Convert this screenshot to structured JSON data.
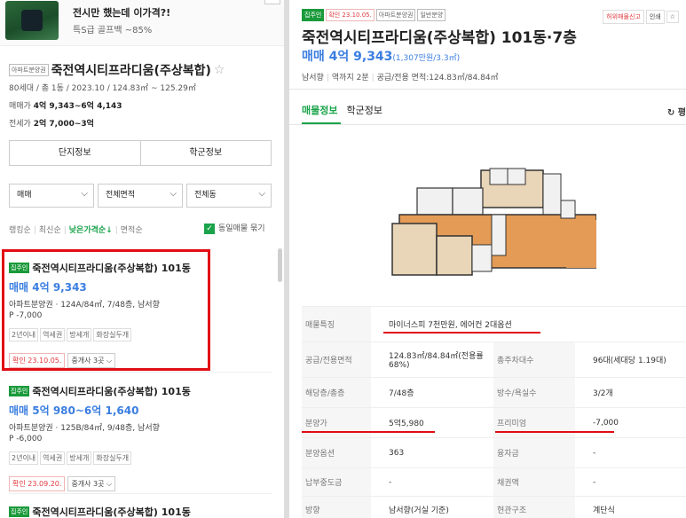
{
  "ad": {
    "title": "전시만 했는데 이가격?!",
    "subtitle": "특S급 골프백 ~85%"
  },
  "complex": {
    "type_tag": "아파트분양권",
    "name": "죽전역시티프라디움(주상복합)",
    "star": "☆",
    "meta": "80세대 / 총 1동 / 2023.10 / 124.83㎡ ~ 125.29㎡",
    "trade_label": "매매가",
    "trade_value": "4억 9,343~6억 4,143",
    "jeonse_label": "전세가",
    "jeonse_value": "2억 7,000~3억",
    "btn_info": "단지정보",
    "btn_school": "학군정보"
  },
  "filters": {
    "f1": "매매",
    "f2": "전체면적",
    "f3": "전체동"
  },
  "sort": {
    "s1": "랭킹순",
    "s2": "최신순",
    "s3": "낮은가격순↓",
    "s4": "면적순",
    "check_mark": "✓",
    "check_label": "동일매물 묶기"
  },
  "listings": [
    {
      "badge": "집주인",
      "name": "죽전역시티프라디움(주상복합) 101동",
      "price": "매매 4억 9,343",
      "desc": "아파트분양권 · 124A/84㎡, 7/48층, 남서향",
      "premium": "P -7,000",
      "kw1": "2년이내",
      "kw2": "역세권",
      "kw3": "방세개",
      "kw4": "화장실두개",
      "confirm": "확인 23.10.05.",
      "agents": "중개사 3곳 ⌵"
    },
    {
      "badge": "집주인",
      "name": "죽전역시티프라디움(주상복합) 101동",
      "price": "매매 5억 980~6억 1,640",
      "desc": "아파트분양권 · 125B/84㎡, 9/48층, 남서향",
      "premium": "P -6,000",
      "kw1": "2년이내",
      "kw2": "역세권",
      "kw3": "방세개",
      "kw4": "화장실두개",
      "confirm": "확인 23.09.20.",
      "agents": "중개사 3곳 ⌵"
    },
    {
      "badge": "집주인",
      "name": "죽전역시티프라디움(주상복합) 101동"
    }
  ],
  "detail": {
    "tag_owner": "집주인",
    "tag_confirm": "확인 23.10.05.",
    "tag_type": "아파트분양권",
    "tag_kind": "일반분양",
    "report": "허위매물신고",
    "print": "인쇄",
    "title": "죽전역시티프라디움(주상복합) 101동·7층",
    "price": "매매 4억 9,343",
    "price_unit": "(1,307만원/3.3㎡)",
    "direction": "남서향",
    "stairs": "역까지 2분",
    "area": "공급/전용 면적:124.83㎡/84.84㎡",
    "tab1": "매물정보",
    "tab2": "학군정보",
    "refresh": "↻ 평",
    "rows": {
      "feat_k": "매물특징",
      "feat_v": "마이너스피 7천만원, 에어컨 2대옵션",
      "area_k": "공급/전용면적",
      "area_v": "124.83㎡/84.84㎡(전용률68%)",
      "hh_k": "총주차대수",
      "hh_v": "96대(세대당 1.19대)",
      "floor_k": "해당층/총층",
      "floor_v": "7/48층",
      "room_k": "방수/욕실수",
      "room_v": "3/2개",
      "sale_k": "분양가",
      "sale_v": "5억5,980",
      "prem_k": "프리미엄",
      "prem_v": "-7,000",
      "opt_k": "분양옵션",
      "opt_v": "363",
      "loan_k": "융자금",
      "loan_v": "-",
      "paid_k": "납부중도금",
      "paid_v": "-",
      "right_k": "채권액",
      "right_v": "-",
      "dir_k": "방향",
      "dir_v": "남서향(거실 기준)",
      "heat_k": "현관구조",
      "heat_v": "계단식"
    }
  }
}
